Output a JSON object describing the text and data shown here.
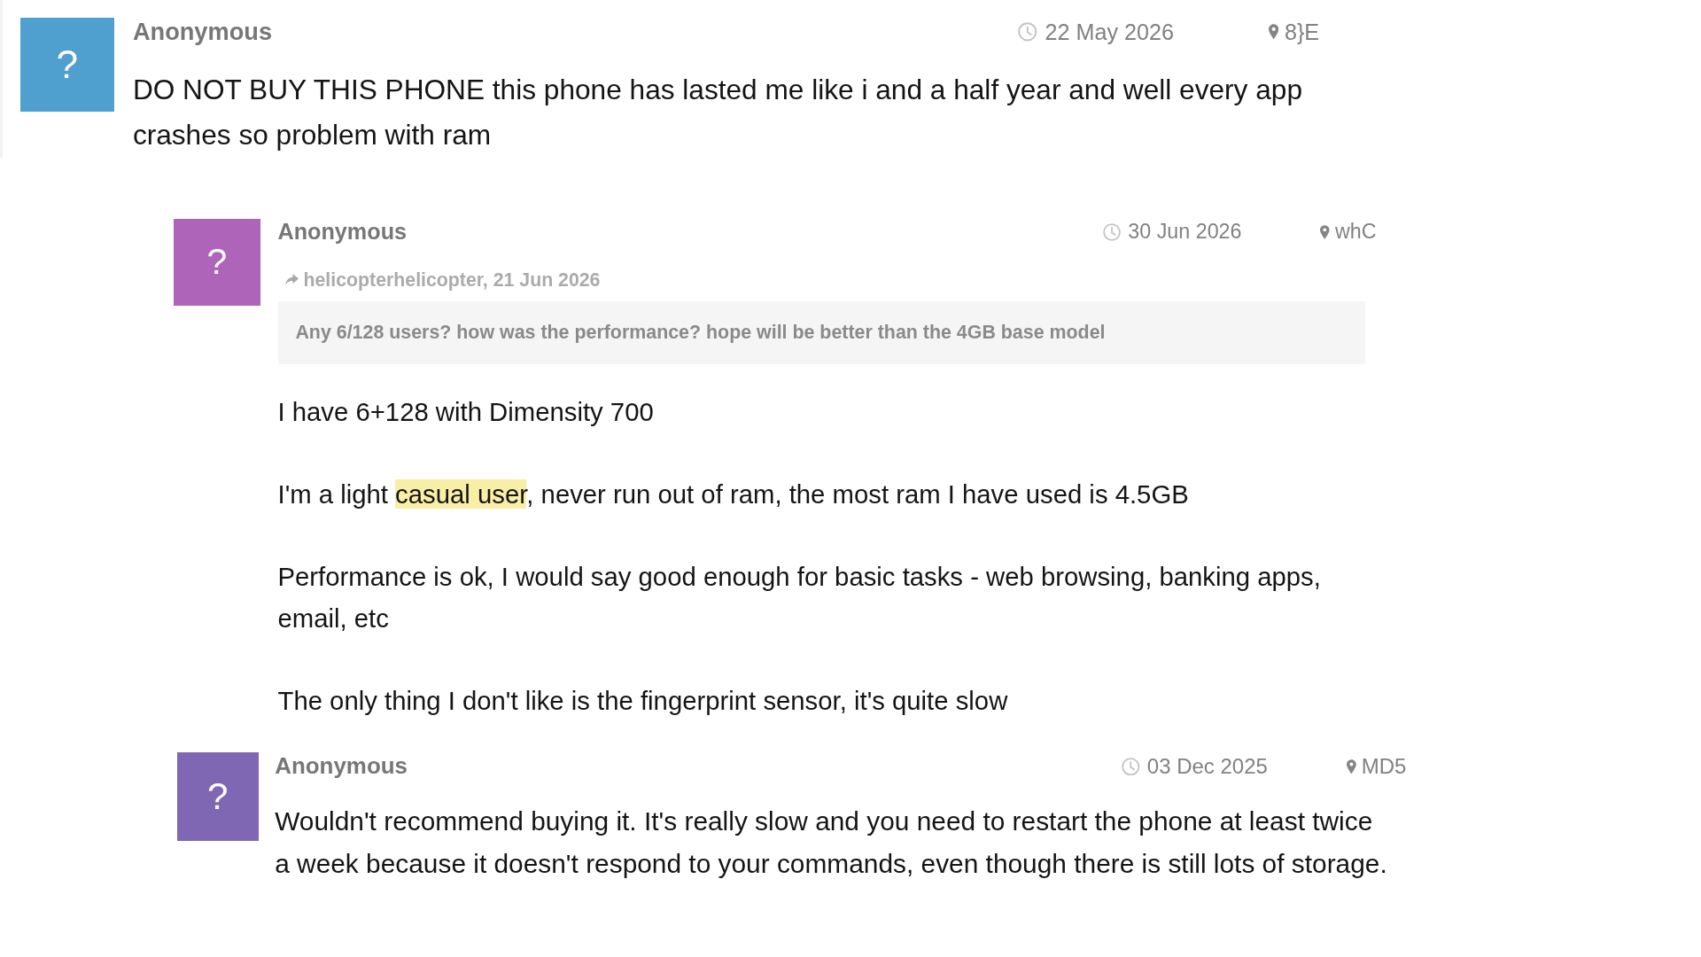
{
  "comments": [
    {
      "avatar": {
        "text": "?",
        "color": "#4f9fcf"
      },
      "author": "Anonymous",
      "date": "22 May 2026",
      "location": "8}E",
      "paragraphs": [
        [
          {
            "text": "DO NOT BUY THIS PHONE this phone has lasted me like i and a half year and well every app crashes so problem with ram",
            "highlighted": false
          }
        ]
      ]
    },
    {
      "avatar": {
        "text": "?",
        "color": "#ae64b8"
      },
      "author": "Anonymous",
      "date": "30 Jun 2026",
      "location": "whC",
      "quote": {
        "source": "helicopterhelicopter, 21 Jun 2026",
        "text": "Any 6/128 users? how was the performance? hope will be better than the 4GB base model"
      },
      "paragraphs": [
        [
          {
            "text": "I have 6+128 with Dimensity 700",
            "highlighted": false
          }
        ],
        [
          {
            "text": "I'm a light ",
            "highlighted": false
          },
          {
            "text": "casual user",
            "highlighted": true
          },
          {
            "text": ", never run out of ram, the most ram I have used is 4.5GB",
            "highlighted": false
          }
        ],
        [
          {
            "text": "Performance is ok, I would say good enough for basic tasks - web browsing, banking apps, email, etc",
            "highlighted": false
          }
        ],
        [
          {
            "text": "The only thing I don't like is the fingerprint sensor, it's quite slow",
            "highlighted": false
          }
        ]
      ]
    },
    {
      "avatar": {
        "text": "?",
        "color": "#7f67b4"
      },
      "author": "Anonymous",
      "date": "03 Dec 2025",
      "location": "MD5",
      "paragraphs": [
        [
          {
            "text": "Wouldn't recommend buying it. It's really slow and you need to restart the phone at least twice a week because it doesn't respond to your commands, even though there is still lots of storage.",
            "highlighted": false
          }
        ]
      ]
    }
  ]
}
